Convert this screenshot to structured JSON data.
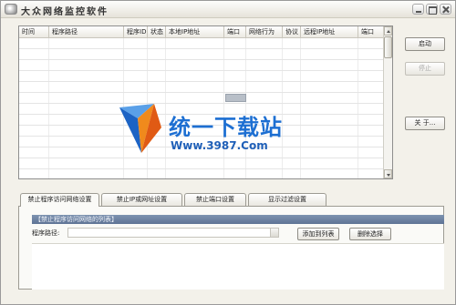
{
  "window": {
    "title": "大众网络监控软件",
    "colors": {
      "chrome": "#f3f1ea",
      "group_header": "#6f84a4",
      "watermark_blue": "#1d6fd2"
    }
  },
  "table": {
    "columns": [
      "时间",
      "程序路径",
      "程序ID",
      "状态",
      "本地IP地址",
      "端口",
      "网络行为",
      "协议",
      "远程IP地址",
      "端口"
    ],
    "row_count": 13
  },
  "buttons": {
    "start": "启动",
    "stop": "停止",
    "about": "关 于..."
  },
  "watermark": {
    "brand": "统一下载站",
    "url": "Www.3987.Com"
  },
  "tabs": [
    {
      "label": "禁止程序访问网络设置",
      "active": true
    },
    {
      "label": "禁止IP或网址设置",
      "active": false
    },
    {
      "label": "禁止端口设置",
      "active": false
    },
    {
      "label": "显示过滤设置",
      "active": false
    }
  ],
  "panel": {
    "group_title": "【禁止程序访问网络的列表】",
    "path_label": "程序路径:",
    "path_value": "",
    "add_button": "添加到列表",
    "delete_button": "删除选择"
  }
}
